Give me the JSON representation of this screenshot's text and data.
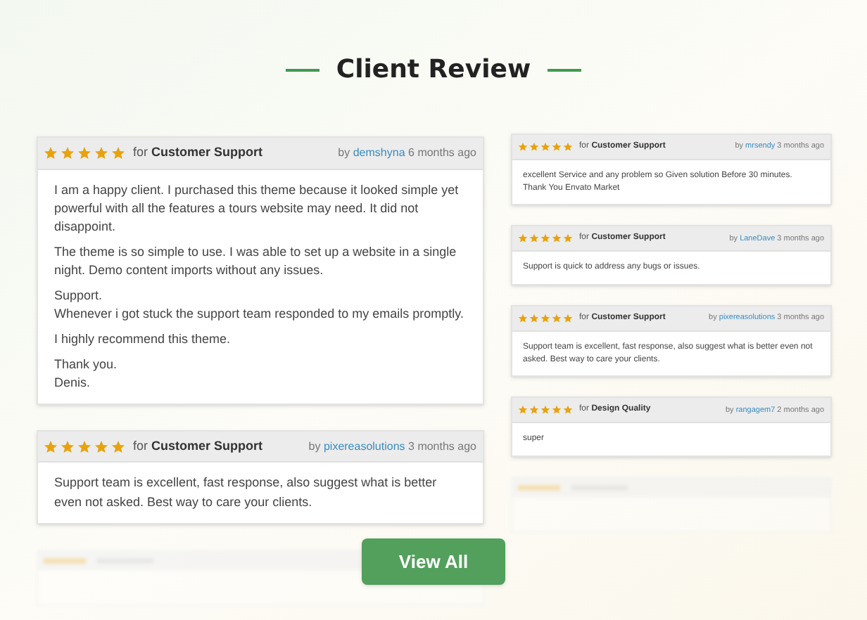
{
  "section": {
    "title": "Client Review"
  },
  "left_reviews": [
    {
      "stars": 5,
      "for_label": "for",
      "category": "Customer Support",
      "by_label": "by",
      "author": "demshyna",
      "time": "6 months ago",
      "paragraphs": [
        "I am a happy client. I purchased this theme because it looked simple yet powerful with all the features a tours website may need. It did not disappoint.",
        "The theme is so simple to use. I was able to set up a website in a single night. Demo content imports without any issues.",
        "Support.\nWhenever i got stuck the support team responded to my emails promptly.",
        "I highly recommend this theme.",
        "Thank you.\nDenis."
      ]
    },
    {
      "stars": 5,
      "for_label": "for",
      "category": "Customer Support",
      "by_label": "by",
      "author": "pixereasolutions",
      "time": "3 months ago",
      "paragraphs": [
        "Support team is excellent, fast response, also suggest what is better even not asked. Best way to care your clients."
      ]
    }
  ],
  "right_reviews": [
    {
      "stars": 5,
      "for_label": "for",
      "category": "Customer Support",
      "by_label": "by",
      "author": "mrsendy",
      "time": "3 months ago",
      "paragraphs": [
        "excellent Service and any problem so Given solution Before 30 minutes.\nThank You Envato Market"
      ]
    },
    {
      "stars": 5,
      "for_label": "for",
      "category": "Customer Support",
      "by_label": "by",
      "author": "LaneDave",
      "time": "3 months ago",
      "paragraphs": [
        "Support is quick to address any bugs or issues."
      ]
    },
    {
      "stars": 5,
      "for_label": "for",
      "category": "Customer Support",
      "by_label": "by",
      "author": "pixereasolutions",
      "time": "3 months ago",
      "paragraphs": [
        "Support team is excellent, fast response, also suggest what is better even not asked. Best way to care your clients."
      ]
    },
    {
      "stars": 5,
      "for_label": "for",
      "category": "Design Quality",
      "by_label": "by",
      "author": "rangagem7",
      "time": "2 months ago",
      "paragraphs": [
        "super"
      ]
    }
  ],
  "view_all": {
    "label": "View All"
  }
}
